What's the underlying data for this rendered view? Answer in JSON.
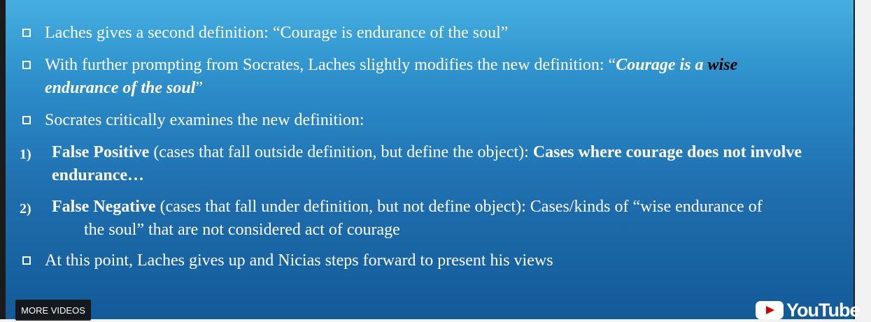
{
  "slide": {
    "items": [
      {
        "type": "bullet",
        "parts": {
          "a": "Laches gives a second definition: “Courage is endurance of the soul”"
        }
      },
      {
        "type": "bullet",
        "parts": {
          "a": "With further prompting from Socrates, Laches slightly modifies the new definition: “",
          "b": "Courage is a ",
          "c": "wise",
          "d": "endurance of the soul",
          "e": "”"
        }
      },
      {
        "type": "bullet",
        "parts": {
          "a": "Socrates critically examines the new definition:"
        }
      },
      {
        "type": "numbered",
        "number": "1)",
        "parts": {
          "a": "False Positive",
          "b": " (cases that fall outside definition, but define the object): ",
          "c": "Cases where courage does not involve endurance…"
        }
      },
      {
        "type": "numbered",
        "number": "2)",
        "parts": {
          "a": "False Negative",
          "b": " (cases that fall under definition, but not define object): Cases/kinds of “wise endurance of",
          "c": "the soul” that are not considered act of courage"
        }
      },
      {
        "type": "bullet",
        "parts": {
          "a": "At this point, Laches gives up and Nicias steps forward to present his views"
        }
      }
    ]
  },
  "player": {
    "more_videos_label": "MORE VIDEOS",
    "logo_text": "YouTube",
    "logo_icon": "youtube-play-icon"
  }
}
